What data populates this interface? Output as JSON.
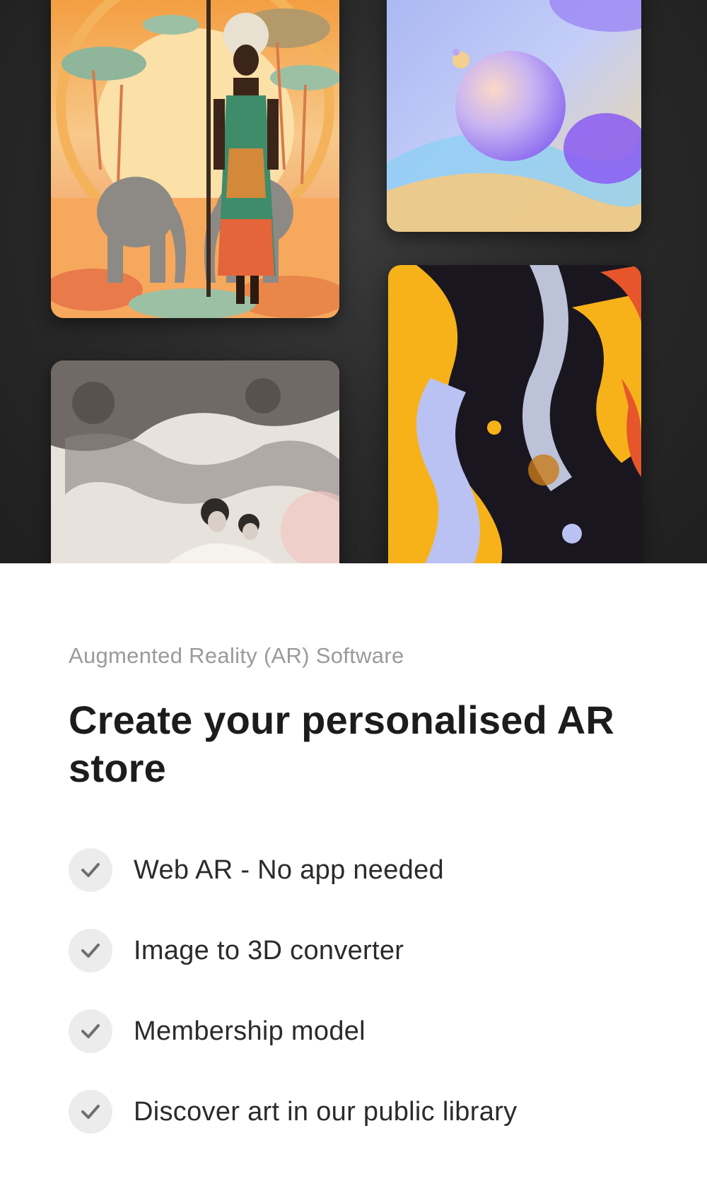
{
  "gallery": {
    "images": [
      {
        "name": "african-woman-elephants-artwork",
        "icon": "artwork-thumbnail"
      },
      {
        "name": "pastel-sphere-artwork",
        "icon": "artwork-thumbnail"
      },
      {
        "name": "vintage-mother-child-photo",
        "icon": "artwork-thumbnail"
      },
      {
        "name": "fluid-marble-abstract-artwork",
        "icon": "artwork-thumbnail"
      }
    ]
  },
  "section": {
    "eyebrow": "Augmented Reality (AR) Software",
    "headline": "Create your personalised AR store"
  },
  "features": [
    {
      "label": "Web AR - No app needed",
      "icon": "checkmark-icon"
    },
    {
      "label": "Image to 3D converter",
      "icon": "checkmark-icon"
    },
    {
      "label": "Membership model",
      "icon": "checkmark-icon"
    },
    {
      "label": "Discover art in our public library",
      "icon": "checkmark-icon"
    }
  ],
  "colors": {
    "hero_background": "#262626",
    "headline": "#1c1c1c",
    "eyebrow": "#9a9a9a",
    "check_circle": "#ececec",
    "check_mark": "#6f6f6f"
  }
}
